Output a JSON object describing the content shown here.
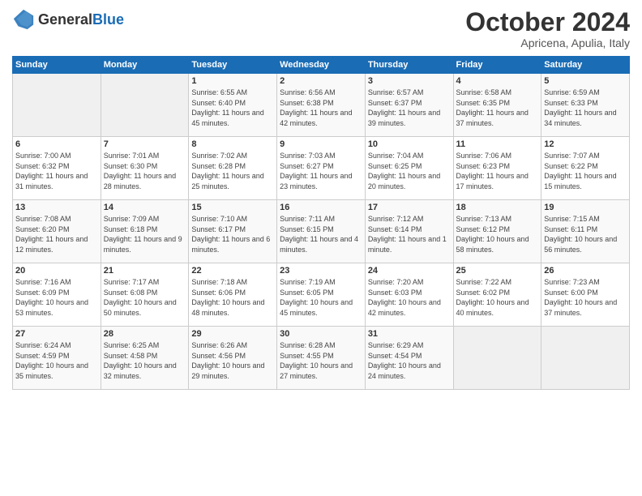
{
  "logo": {
    "general": "General",
    "blue": "Blue"
  },
  "header": {
    "month": "October 2024",
    "location": "Apricena, Apulia, Italy"
  },
  "days_of_week": [
    "Sunday",
    "Monday",
    "Tuesday",
    "Wednesday",
    "Thursday",
    "Friday",
    "Saturday"
  ],
  "weeks": [
    [
      {
        "day": "",
        "sunrise": "",
        "sunset": "",
        "daylight": ""
      },
      {
        "day": "",
        "sunrise": "",
        "sunset": "",
        "daylight": ""
      },
      {
        "day": "1",
        "sunrise": "Sunrise: 6:55 AM",
        "sunset": "Sunset: 6:40 PM",
        "daylight": "Daylight: 11 hours and 45 minutes."
      },
      {
        "day": "2",
        "sunrise": "Sunrise: 6:56 AM",
        "sunset": "Sunset: 6:38 PM",
        "daylight": "Daylight: 11 hours and 42 minutes."
      },
      {
        "day": "3",
        "sunrise": "Sunrise: 6:57 AM",
        "sunset": "Sunset: 6:37 PM",
        "daylight": "Daylight: 11 hours and 39 minutes."
      },
      {
        "day": "4",
        "sunrise": "Sunrise: 6:58 AM",
        "sunset": "Sunset: 6:35 PM",
        "daylight": "Daylight: 11 hours and 37 minutes."
      },
      {
        "day": "5",
        "sunrise": "Sunrise: 6:59 AM",
        "sunset": "Sunset: 6:33 PM",
        "daylight": "Daylight: 11 hours and 34 minutes."
      }
    ],
    [
      {
        "day": "6",
        "sunrise": "Sunrise: 7:00 AM",
        "sunset": "Sunset: 6:32 PM",
        "daylight": "Daylight: 11 hours and 31 minutes."
      },
      {
        "day": "7",
        "sunrise": "Sunrise: 7:01 AM",
        "sunset": "Sunset: 6:30 PM",
        "daylight": "Daylight: 11 hours and 28 minutes."
      },
      {
        "day": "8",
        "sunrise": "Sunrise: 7:02 AM",
        "sunset": "Sunset: 6:28 PM",
        "daylight": "Daylight: 11 hours and 25 minutes."
      },
      {
        "day": "9",
        "sunrise": "Sunrise: 7:03 AM",
        "sunset": "Sunset: 6:27 PM",
        "daylight": "Daylight: 11 hours and 23 minutes."
      },
      {
        "day": "10",
        "sunrise": "Sunrise: 7:04 AM",
        "sunset": "Sunset: 6:25 PM",
        "daylight": "Daylight: 11 hours and 20 minutes."
      },
      {
        "day": "11",
        "sunrise": "Sunrise: 7:06 AM",
        "sunset": "Sunset: 6:23 PM",
        "daylight": "Daylight: 11 hours and 17 minutes."
      },
      {
        "day": "12",
        "sunrise": "Sunrise: 7:07 AM",
        "sunset": "Sunset: 6:22 PM",
        "daylight": "Daylight: 11 hours and 15 minutes."
      }
    ],
    [
      {
        "day": "13",
        "sunrise": "Sunrise: 7:08 AM",
        "sunset": "Sunset: 6:20 PM",
        "daylight": "Daylight: 11 hours and 12 minutes."
      },
      {
        "day": "14",
        "sunrise": "Sunrise: 7:09 AM",
        "sunset": "Sunset: 6:18 PM",
        "daylight": "Daylight: 11 hours and 9 minutes."
      },
      {
        "day": "15",
        "sunrise": "Sunrise: 7:10 AM",
        "sunset": "Sunset: 6:17 PM",
        "daylight": "Daylight: 11 hours and 6 minutes."
      },
      {
        "day": "16",
        "sunrise": "Sunrise: 7:11 AM",
        "sunset": "Sunset: 6:15 PM",
        "daylight": "Daylight: 11 hours and 4 minutes."
      },
      {
        "day": "17",
        "sunrise": "Sunrise: 7:12 AM",
        "sunset": "Sunset: 6:14 PM",
        "daylight": "Daylight: 11 hours and 1 minute."
      },
      {
        "day": "18",
        "sunrise": "Sunrise: 7:13 AM",
        "sunset": "Sunset: 6:12 PM",
        "daylight": "Daylight: 10 hours and 58 minutes."
      },
      {
        "day": "19",
        "sunrise": "Sunrise: 7:15 AM",
        "sunset": "Sunset: 6:11 PM",
        "daylight": "Daylight: 10 hours and 56 minutes."
      }
    ],
    [
      {
        "day": "20",
        "sunrise": "Sunrise: 7:16 AM",
        "sunset": "Sunset: 6:09 PM",
        "daylight": "Daylight: 10 hours and 53 minutes."
      },
      {
        "day": "21",
        "sunrise": "Sunrise: 7:17 AM",
        "sunset": "Sunset: 6:08 PM",
        "daylight": "Daylight: 10 hours and 50 minutes."
      },
      {
        "day": "22",
        "sunrise": "Sunrise: 7:18 AM",
        "sunset": "Sunset: 6:06 PM",
        "daylight": "Daylight: 10 hours and 48 minutes."
      },
      {
        "day": "23",
        "sunrise": "Sunrise: 7:19 AM",
        "sunset": "Sunset: 6:05 PM",
        "daylight": "Daylight: 10 hours and 45 minutes."
      },
      {
        "day": "24",
        "sunrise": "Sunrise: 7:20 AM",
        "sunset": "Sunset: 6:03 PM",
        "daylight": "Daylight: 10 hours and 42 minutes."
      },
      {
        "day": "25",
        "sunrise": "Sunrise: 7:22 AM",
        "sunset": "Sunset: 6:02 PM",
        "daylight": "Daylight: 10 hours and 40 minutes."
      },
      {
        "day": "26",
        "sunrise": "Sunrise: 7:23 AM",
        "sunset": "Sunset: 6:00 PM",
        "daylight": "Daylight: 10 hours and 37 minutes."
      }
    ],
    [
      {
        "day": "27",
        "sunrise": "Sunrise: 6:24 AM",
        "sunset": "Sunset: 4:59 PM",
        "daylight": "Daylight: 10 hours and 35 minutes."
      },
      {
        "day": "28",
        "sunrise": "Sunrise: 6:25 AM",
        "sunset": "Sunset: 4:58 PM",
        "daylight": "Daylight: 10 hours and 32 minutes."
      },
      {
        "day": "29",
        "sunrise": "Sunrise: 6:26 AM",
        "sunset": "Sunset: 4:56 PM",
        "daylight": "Daylight: 10 hours and 29 minutes."
      },
      {
        "day": "30",
        "sunrise": "Sunrise: 6:28 AM",
        "sunset": "Sunset: 4:55 PM",
        "daylight": "Daylight: 10 hours and 27 minutes."
      },
      {
        "day": "31",
        "sunrise": "Sunrise: 6:29 AM",
        "sunset": "Sunset: 4:54 PM",
        "daylight": "Daylight: 10 hours and 24 minutes."
      },
      {
        "day": "",
        "sunrise": "",
        "sunset": "",
        "daylight": ""
      },
      {
        "day": "",
        "sunrise": "",
        "sunset": "",
        "daylight": ""
      }
    ]
  ]
}
